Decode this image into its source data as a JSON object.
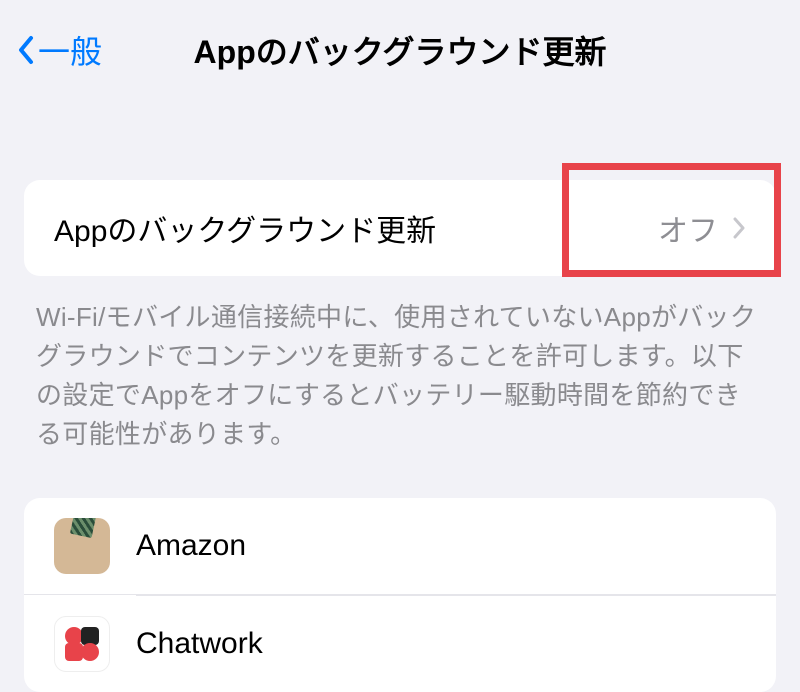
{
  "nav": {
    "back_label": "一般",
    "title": "Appのバックグラウンド更新"
  },
  "main_setting": {
    "label": "Appのバックグラウンド更新",
    "value": "オフ"
  },
  "footer_text": "Wi-Fi/モバイル通信接続中に、使用されていないAppがバックグラウンドでコンテンツを更新することを許可します。以下の設定でAppをオフにするとバッテリー駆動時間を節約できる可能性があります。",
  "apps": [
    {
      "name": "Amazon",
      "icon": "amazon-icon"
    },
    {
      "name": "Chatwork",
      "icon": "chatwork-icon"
    }
  ]
}
